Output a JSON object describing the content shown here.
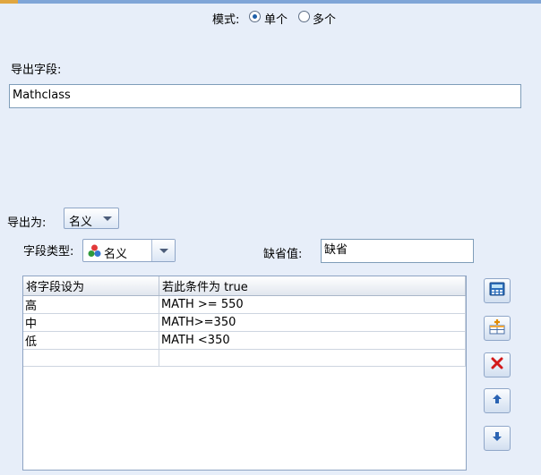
{
  "mode": {
    "label": "模式:",
    "options": [
      {
        "label": "单个",
        "selected": true
      },
      {
        "label": "多个",
        "selected": false
      }
    ]
  },
  "derive_field": {
    "label": "导出字段:",
    "value": "Mathclass"
  },
  "derive_as": {
    "label": "导出为:",
    "value": "名义"
  },
  "field_type": {
    "label": "字段类型:",
    "value": "名义"
  },
  "default_value": {
    "label": "缺省值:",
    "value": "缺省"
  },
  "table": {
    "columns": [
      "将字段设为",
      "若此条件为 true"
    ],
    "rows": [
      [
        "高",
        "MATH >= 550"
      ],
      [
        "中",
        "MATH>=350"
      ],
      [
        "低",
        "MATH <350"
      ],
      [
        "",
        ""
      ]
    ]
  },
  "side_buttons": [
    "expression-builder-icon",
    "add-row-icon",
    "delete-icon",
    "move-up-icon",
    "move-down-icon"
  ],
  "colors": {
    "panel_bg": "#e7eef9",
    "accent": "#1f5fa8",
    "delete": "#d31a1a"
  }
}
